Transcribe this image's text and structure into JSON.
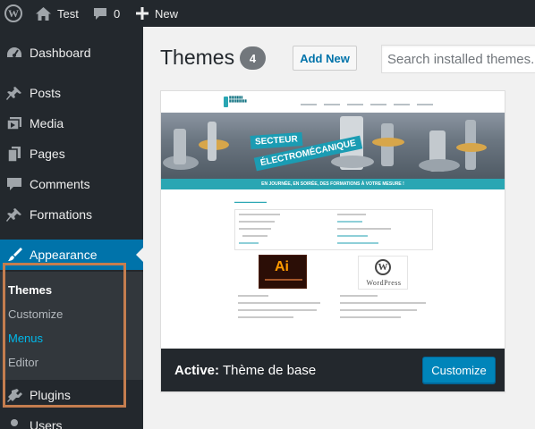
{
  "adminbar": {
    "site_name": "Test",
    "comments_count": "0",
    "new_label": "New"
  },
  "sidebar": {
    "items": [
      {
        "label": "Dashboard",
        "icon": "dashboard-icon"
      },
      {
        "label": "Posts",
        "icon": "pushpin-icon"
      },
      {
        "label": "Media",
        "icon": "media-icon"
      },
      {
        "label": "Pages",
        "icon": "pages-icon"
      },
      {
        "label": "Comments",
        "icon": "comment-icon"
      },
      {
        "label": "Formations",
        "icon": "pushpin-icon"
      },
      {
        "label": "Appearance",
        "icon": "paintbrush-icon"
      },
      {
        "label": "Plugins",
        "icon": "plugin-icon"
      },
      {
        "label": "Users",
        "icon": "users-icon"
      }
    ],
    "submenu": [
      {
        "label": "Themes"
      },
      {
        "label": "Customize"
      },
      {
        "label": "Menus"
      },
      {
        "label": "Editor"
      }
    ]
  },
  "main": {
    "title": "Themes",
    "count": "4",
    "add_new_label": "Add New",
    "search_placeholder": "Search installed themes..."
  },
  "theme": {
    "active_prefix": "Active:",
    "name": "Thème de base",
    "customize_label": "Customize",
    "screenshot": {
      "banner_line1": "SECTEUR",
      "banner_line2": "ÉLECTROMÉCANIQUE",
      "strip_text": "EN JOURNÉE, EN SOIRÉE, DES FORMATIONS À VOTRE MESURE !",
      "ai_logo": "Ai",
      "wp_word": "WordPress"
    }
  },
  "colors": {
    "adminbar_bg": "#23282d",
    "accent": "#0073aa",
    "button_primary": "#0085ba",
    "highlight_border": "#c47d4f"
  }
}
